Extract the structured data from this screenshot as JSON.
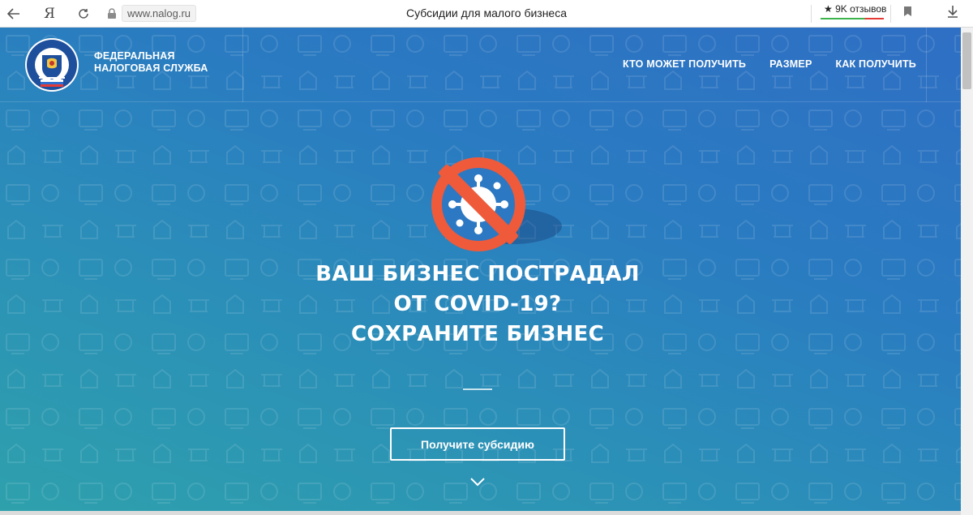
{
  "browser": {
    "back_icon": "arrow-left-icon",
    "yandex_label": "Я",
    "reload_icon": "reload-icon",
    "lock_icon": "lock-icon",
    "url": "www.nalog.ru",
    "tab_title": "Субсидии для малого бизнеса",
    "reviews_label": "★ 9K отзывов",
    "bookmark_icon": "bookmark-icon",
    "download_icon": "download-icon"
  },
  "header": {
    "brand_line1": "ФЕДЕРАЛЬНАЯ",
    "brand_line2": "НАЛОГОВАЯ СЛУЖБА",
    "menu": [
      {
        "label": "КТО МОЖЕТ ПОЛУЧИТЬ"
      },
      {
        "label": "РАЗМЕР"
      },
      {
        "label": "КАК ПОЛУЧИТЬ"
      }
    ]
  },
  "hero": {
    "headline_line1": "ВАШ БИЗНЕС ПОСТРАДАЛ",
    "headline_line2": "ОТ COVID-19?",
    "headline_line3": "СОХРАНИТЕ БИЗНЕС",
    "cta_label": "Получите субсидию",
    "scroll_icon": "chevron-down-icon"
  },
  "colors": {
    "bg_top": "#2f6fc4",
    "bg_bottom": "#2ea1ac",
    "prohibition_red": "#ef5a3a",
    "virus_inner": "#2d78c2"
  }
}
